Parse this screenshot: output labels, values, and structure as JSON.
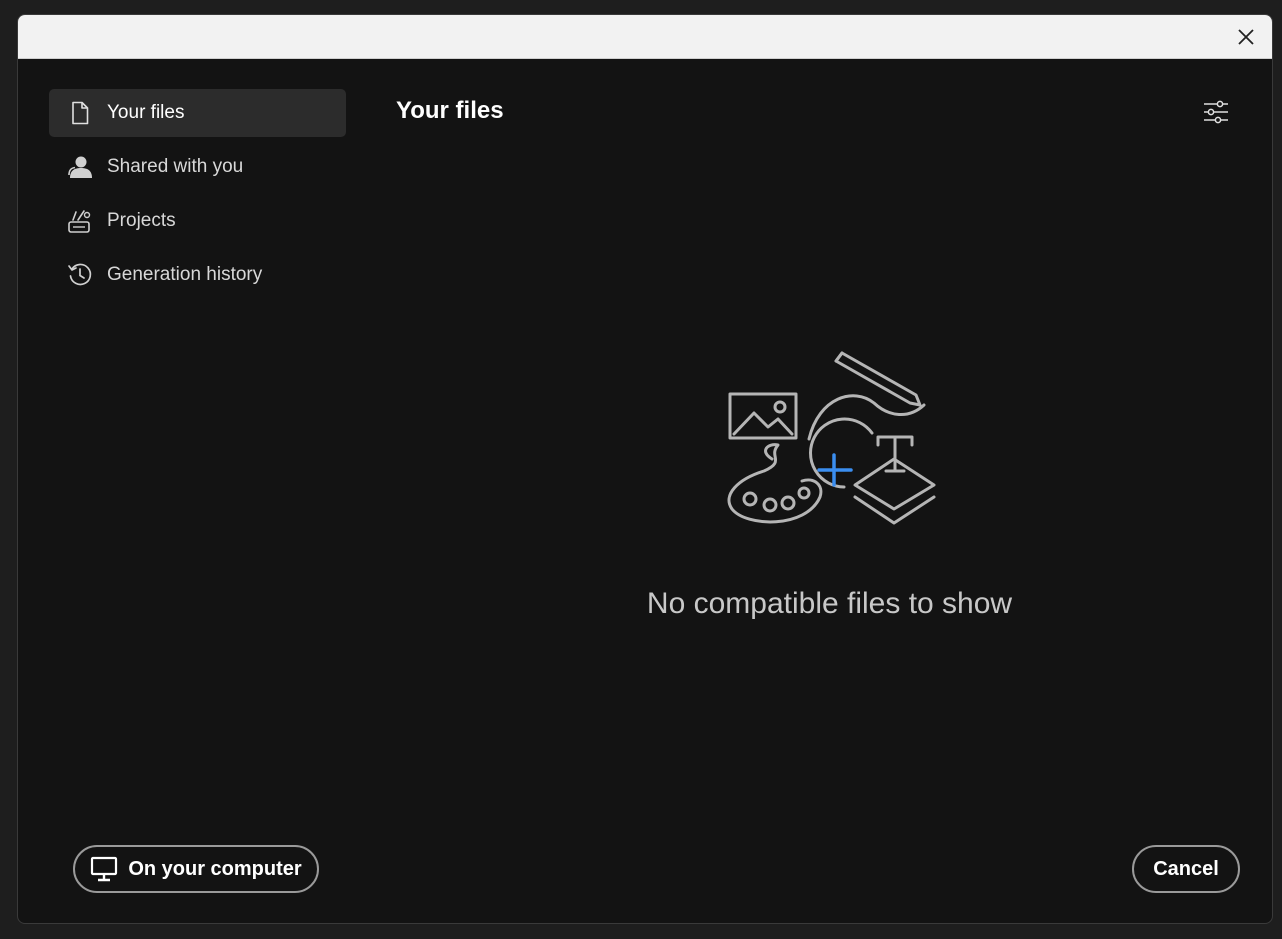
{
  "window": {
    "close_icon": "close-icon"
  },
  "sidebar": {
    "items": [
      {
        "label": "Your files",
        "icon": "document-icon",
        "active": true
      },
      {
        "label": "Shared with you",
        "icon": "user-icon",
        "active": false
      },
      {
        "label": "Projects",
        "icon": "projects-icon",
        "active": false
      },
      {
        "label": "Generation history",
        "icon": "history-icon",
        "active": false
      }
    ]
  },
  "main": {
    "title": "Your files",
    "filter_icon": "filter-sliders-icon",
    "empty_state": {
      "illustration": "create-content-illustration",
      "message": "No compatible files to show"
    }
  },
  "footer": {
    "on_computer_label": "On your computer",
    "on_computer_icon": "monitor-icon",
    "cancel_label": "Cancel"
  },
  "colors": {
    "background": "#131313",
    "titlebar": "#f2f2f2",
    "active_item": "#2c2c2c",
    "accent": "#3b8ef0",
    "illustration": "#b5b5b5"
  }
}
